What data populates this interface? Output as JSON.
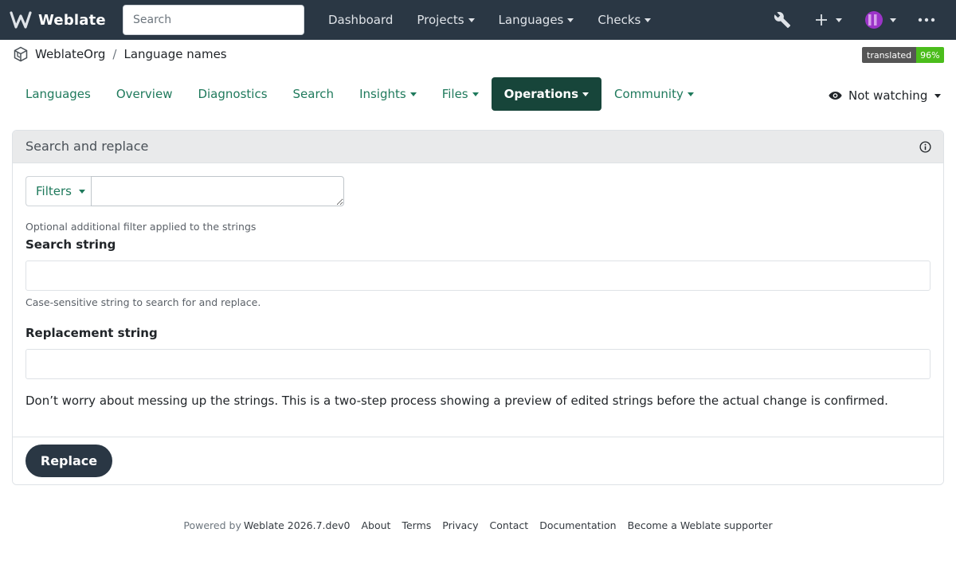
{
  "app": {
    "brand": "Weblate"
  },
  "navbar": {
    "search_placeholder": "Search",
    "links": [
      {
        "label": "Dashboard",
        "dropdown": false
      },
      {
        "label": "Projects",
        "dropdown": true
      },
      {
        "label": "Languages",
        "dropdown": true
      },
      {
        "label": "Checks",
        "dropdown": true
      }
    ],
    "icons": {
      "tools": "wrench-icon",
      "add": "plus-icon",
      "user": "avatar",
      "more": "ellipsis-icon"
    }
  },
  "breadcrumb": {
    "project": "WeblateOrg",
    "separator": "/",
    "component": "Language names"
  },
  "badge": {
    "label": "translated",
    "value": "96%"
  },
  "tabs": [
    {
      "label": "Languages",
      "dropdown": false,
      "active": false
    },
    {
      "label": "Overview",
      "dropdown": false,
      "active": false
    },
    {
      "label": "Diagnostics",
      "dropdown": false,
      "active": false
    },
    {
      "label": "Search",
      "dropdown": false,
      "active": false
    },
    {
      "label": "Insights",
      "dropdown": true,
      "active": false
    },
    {
      "label": "Files",
      "dropdown": true,
      "active": false
    },
    {
      "label": "Operations",
      "dropdown": true,
      "active": true
    },
    {
      "label": "Community",
      "dropdown": true,
      "active": false
    }
  ],
  "watch": {
    "label": "Not watching"
  },
  "form": {
    "title": "Search and replace",
    "filters_label": "Filters",
    "filter_value": "",
    "filter_help": "Optional additional filter applied to the strings",
    "search_label": "Search string",
    "search_value": "",
    "search_help": "Case-sensitive string to search for and replace.",
    "replace_label": "Replacement string",
    "replace_value": "",
    "note": "Don’t worry about messing up the strings. This is a two-step process showing a preview of edited strings before the actual change is confirmed.",
    "submit_label": "Replace"
  },
  "footer": {
    "powered_by": "Powered by",
    "version_link": "Weblate 2026.7.dev0",
    "links": [
      "About",
      "Terms",
      "Privacy",
      "Contact",
      "Documentation",
      "Become a Weblate supporter"
    ]
  },
  "colors": {
    "navbar_bg": "#2a3744",
    "accent_green": "#1f7a5c",
    "active_tab_bg": "#17453a",
    "badge_green": "#4bbd1c"
  }
}
